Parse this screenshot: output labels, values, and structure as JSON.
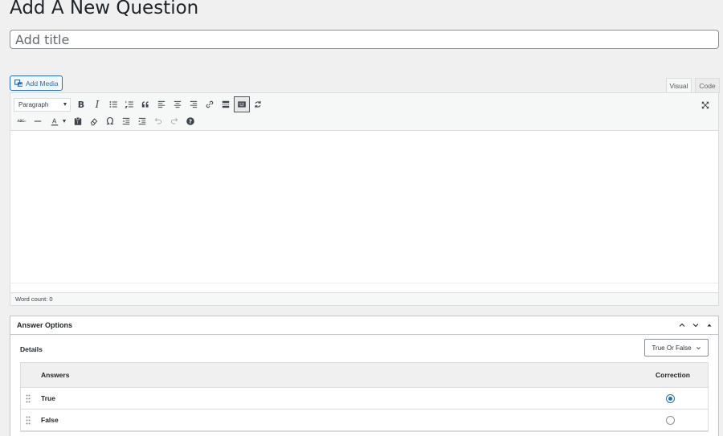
{
  "page": {
    "title": "Add A New Question"
  },
  "title_field": {
    "placeholder": "Add title",
    "value": ""
  },
  "editor": {
    "add_media_label": "Add Media",
    "tabs": [
      {
        "label": "Visual",
        "active": true
      },
      {
        "label": "Code",
        "active": false
      }
    ],
    "format_select": "Paragraph",
    "word_count": "Word count: 0"
  },
  "answer_options": {
    "title": "Answer Options",
    "details_label": "Details",
    "type_select": "True Or False",
    "columns": {
      "answers": "Answers",
      "correction": "Correction"
    },
    "rows": [
      {
        "label": "True",
        "correct": true
      },
      {
        "label": "False",
        "correct": false
      }
    ]
  },
  "colors": {
    "accent": "#2271b1",
    "border": "#dcdcde",
    "background": "#f0f0f1"
  }
}
